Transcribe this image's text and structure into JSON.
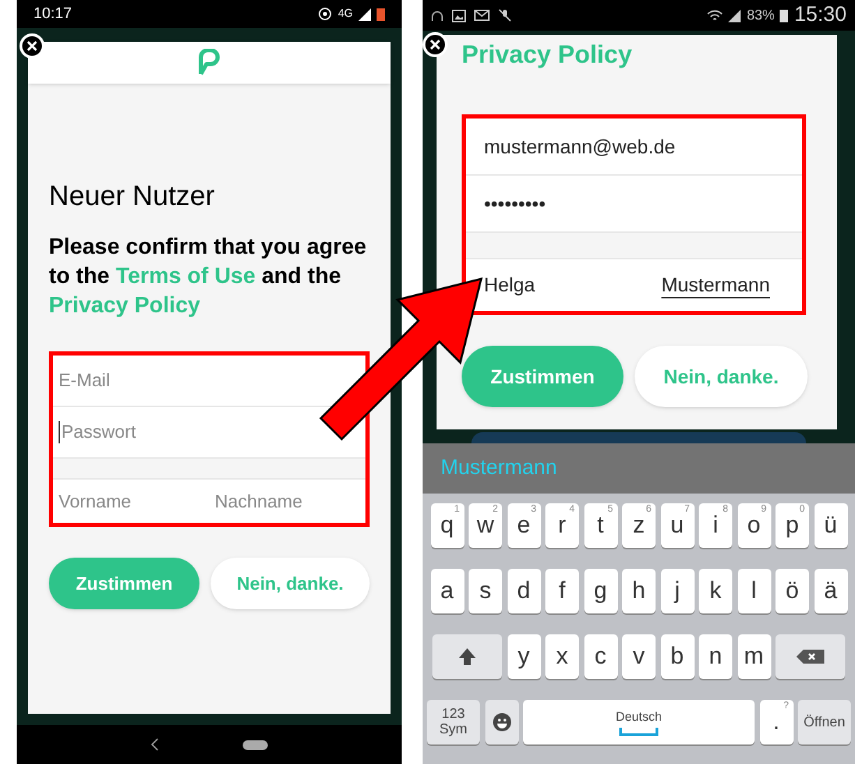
{
  "left_phone": {
    "status_bar": {
      "time": "10:17",
      "network": "4G"
    },
    "dialog": {
      "heading": "Neuer Nutzer",
      "consent": [
        {
          "kind": "text",
          "text": "Please confirm that you agree to the "
        },
        {
          "kind": "link",
          "text": "Terms of Use"
        },
        {
          "kind": "text",
          "text": " and the "
        },
        {
          "kind": "link",
          "text": "Privacy Policy"
        }
      ],
      "fields": [
        {
          "placeholder": "E-Mail",
          "focused": false
        },
        {
          "placeholder": "Passwort",
          "focused": true
        }
      ],
      "name_fields": [
        {
          "placeholder": "Vorname"
        },
        {
          "placeholder": "Nachname"
        }
      ],
      "buttons": [
        {
          "kind": "primary",
          "label": "Zustimmen"
        },
        {
          "kind": "secondary",
          "label": "Nein, danke."
        }
      ]
    }
  },
  "right_phone": {
    "status_bar": {
      "time": "15:30",
      "battery": "83%"
    },
    "dialog": {
      "heading": "Privacy Policy",
      "fields": [
        {
          "value": "mustermann@web.de"
        },
        {
          "value": "•••••••••"
        }
      ],
      "name_fields": [
        {
          "value": "Helga",
          "composing": false
        },
        {
          "value": "Mustermann",
          "composing": true
        }
      ],
      "buttons": [
        {
          "kind": "primary",
          "label": "Zustimmen"
        },
        {
          "kind": "secondary",
          "label": "Nein, danke."
        }
      ]
    },
    "keyboard": {
      "suggestion": "Mustermann",
      "rows": [
        {
          "keys": [
            {
              "kind": "char",
              "label": "q",
              "hint": "1"
            },
            {
              "kind": "char",
              "label": "w",
              "hint": "2"
            },
            {
              "kind": "char",
              "label": "e",
              "hint": "3"
            },
            {
              "kind": "char",
              "label": "r",
              "hint": "4"
            },
            {
              "kind": "char",
              "label": "t",
              "hint": "5"
            },
            {
              "kind": "char",
              "label": "z",
              "hint": "6"
            },
            {
              "kind": "char",
              "label": "u",
              "hint": "7"
            },
            {
              "kind": "char",
              "label": "i",
              "hint": "8"
            },
            {
              "kind": "char",
              "label": "o",
              "hint": "9"
            },
            {
              "kind": "char",
              "label": "p",
              "hint": "0"
            },
            {
              "kind": "char",
              "label": "ü"
            }
          ]
        },
        {
          "keys": [
            {
              "kind": "char",
              "label": "a"
            },
            {
              "kind": "char",
              "label": "s"
            },
            {
              "kind": "char",
              "label": "d"
            },
            {
              "kind": "char",
              "label": "f"
            },
            {
              "kind": "char",
              "label": "g"
            },
            {
              "kind": "char",
              "label": "h"
            },
            {
              "kind": "char",
              "label": "j"
            },
            {
              "kind": "char",
              "label": "k"
            },
            {
              "kind": "char",
              "label": "l"
            },
            {
              "kind": "char",
              "label": "ö"
            },
            {
              "kind": "char",
              "label": "ä"
            }
          ]
        },
        {
          "keys": [
            {
              "kind": "shift"
            },
            {
              "kind": "char",
              "label": "y"
            },
            {
              "kind": "char",
              "label": "x"
            },
            {
              "kind": "char",
              "label": "c"
            },
            {
              "kind": "char",
              "label": "v"
            },
            {
              "kind": "char",
              "label": "b"
            },
            {
              "kind": "char",
              "label": "n"
            },
            {
              "kind": "char",
              "label": "m"
            },
            {
              "kind": "backspace"
            }
          ]
        },
        {
          "keys": [
            {
              "kind": "sym",
              "label": "123",
              "sublabel": "Sym"
            },
            {
              "kind": "emoji"
            },
            {
              "kind": "space",
              "label": "Deutsch"
            },
            {
              "kind": "char",
              "label": ".",
              "hint": "?"
            },
            {
              "kind": "action",
              "label": "Öffnen"
            }
          ]
        }
      ]
    }
  }
}
